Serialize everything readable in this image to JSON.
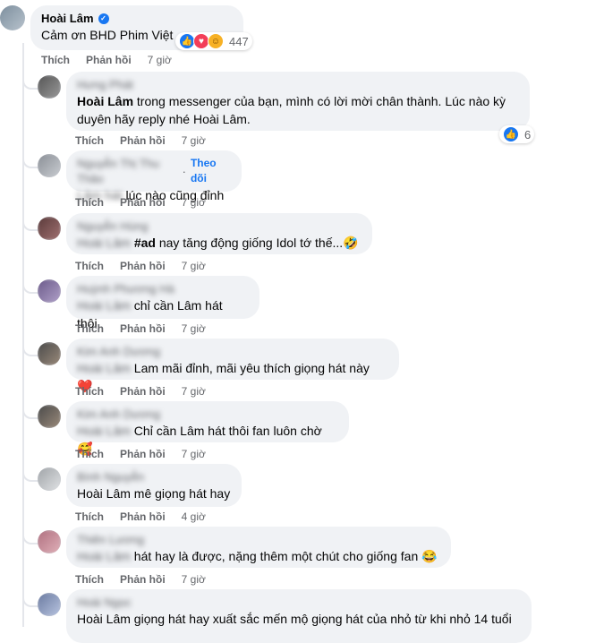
{
  "main_comment": {
    "author": "Hoài Lâm",
    "text": "Cảm ơn BHD Phim Việt",
    "reaction_count": "447",
    "reactions": [
      "like-icon",
      "love-icon",
      "care-icon"
    ],
    "actions": {
      "like": "Thích",
      "reply": "Phản hồi",
      "time": "7 giờ"
    }
  },
  "replies": [
    {
      "author": "Hưng Phát",
      "mention": "Hoài Lâm",
      "text": " trong messenger của bạn, mình có lời mời chân thành. Lúc nào kỳ duyên hãy reply nhé Hoài Lâm.",
      "reaction_count": "6",
      "time": "7 giờ"
    },
    {
      "author": "Nguyễn Thị Thu Thảo",
      "follow": "Theo dõi",
      "mention": "Lâm hát",
      "text": " lúc nào cũng đỉnh",
      "time": "7 giờ"
    },
    {
      "author": "Nguyễn Hùng",
      "mention": "Hoài Lâm",
      "hashtag": "#ad",
      "text": " nay tăng động giống Idol tớ thế...",
      "emoji": "🤣",
      "time": "7 giờ"
    },
    {
      "author": "Huỳnh Phương Hà",
      "mention": "Hoài Lâm",
      "text": " chỉ cần Lâm hát thôi.",
      "time": "7 giờ"
    },
    {
      "author": "Kim Anh Dương",
      "mention": "Hoài Lâm",
      "text": " Lam mãi đỉnh, mãi yêu thích giọng hát này",
      "emoji": "❤️",
      "time": "7 giờ"
    },
    {
      "author": "Kim Anh Dương",
      "mention": "Hoài Lâm",
      "text": " Chỉ cần Lâm hát thôi fan luôn chờ",
      "emoji": "🥰",
      "time": "7 giờ"
    },
    {
      "author": "Bình Nguyễn",
      "mention": "Hoài Lâm",
      "text": " mê giọng hát hay",
      "time": "4 giờ"
    },
    {
      "author": "Thiên Lương",
      "mention": "Hoài Lâm",
      "text": " hát hay là được, nặng thêm một chút cho giống fan",
      "emoji": "😂",
      "time": "7 giờ"
    },
    {
      "author": "Hoài Ngọc",
      "mention": "",
      "text": "Hoài Lâm giọng hát hay xuất sắc mến mộ giọng hát của nhỏ từ khi nhỏ 14 tuổi",
      "time": ""
    }
  ],
  "labels": {
    "like": "Thích",
    "reply": "Phản hồi"
  },
  "colors": {
    "bubble": "#f0f2f5",
    "link": "#1877f2",
    "muted": "#65676b"
  }
}
